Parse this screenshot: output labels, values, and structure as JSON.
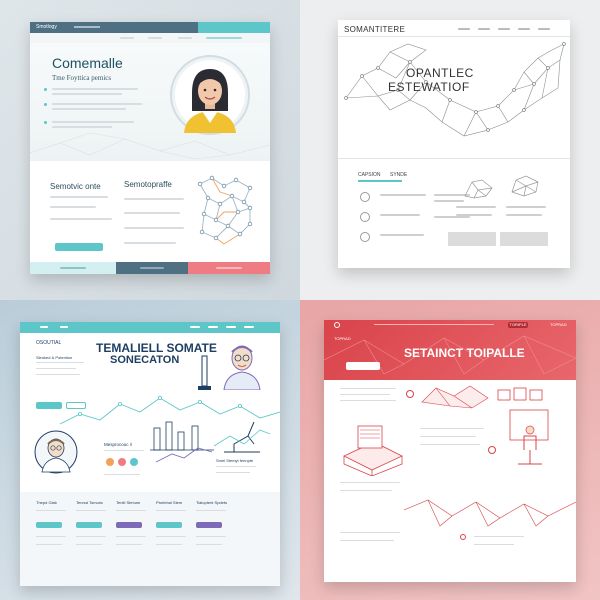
{
  "colors": {
    "teal": "#5cc6c8",
    "slate": "#4f7083",
    "coral": "#ef7c82",
    "red": "#d9434a",
    "navy": "#1e3e63",
    "purple": "#7e6bb8"
  },
  "panel1": {
    "nav_brand": "Smotlogy",
    "headline": "Comemalle",
    "subhead": "Tme Foyttica pemics",
    "section_left": "Semotvic onte",
    "section_right": "Semotopraffe"
  },
  "panel2": {
    "brand": "SOMANTITERE",
    "hero_line1": "OPANTLEC",
    "hero_line2": "ESTEWATIOF",
    "tab1": "CAPSION",
    "tab2": "SYNDE"
  },
  "panel3": {
    "logo": "OSOUTIAL",
    "title_line1": "TEMALIELL SOMATE",
    "title_line2": "SONECATON",
    "left_label": "Slenked & Potention",
    "mid_label": "Mesprocouc i!",
    "right_label": "Smel Stemyt fennpte",
    "columns": [
      "Thepd Glab",
      "Tenrsd Tomoric",
      "Tenitl Sbriune",
      "Ptorlebal Stem",
      "Tialoptent Spdets"
    ]
  },
  "panel4": {
    "hero_title": "SETAINCT TOIPALLE",
    "nav_button": "TORIPLE",
    "nav_label": "TOPRAD"
  }
}
